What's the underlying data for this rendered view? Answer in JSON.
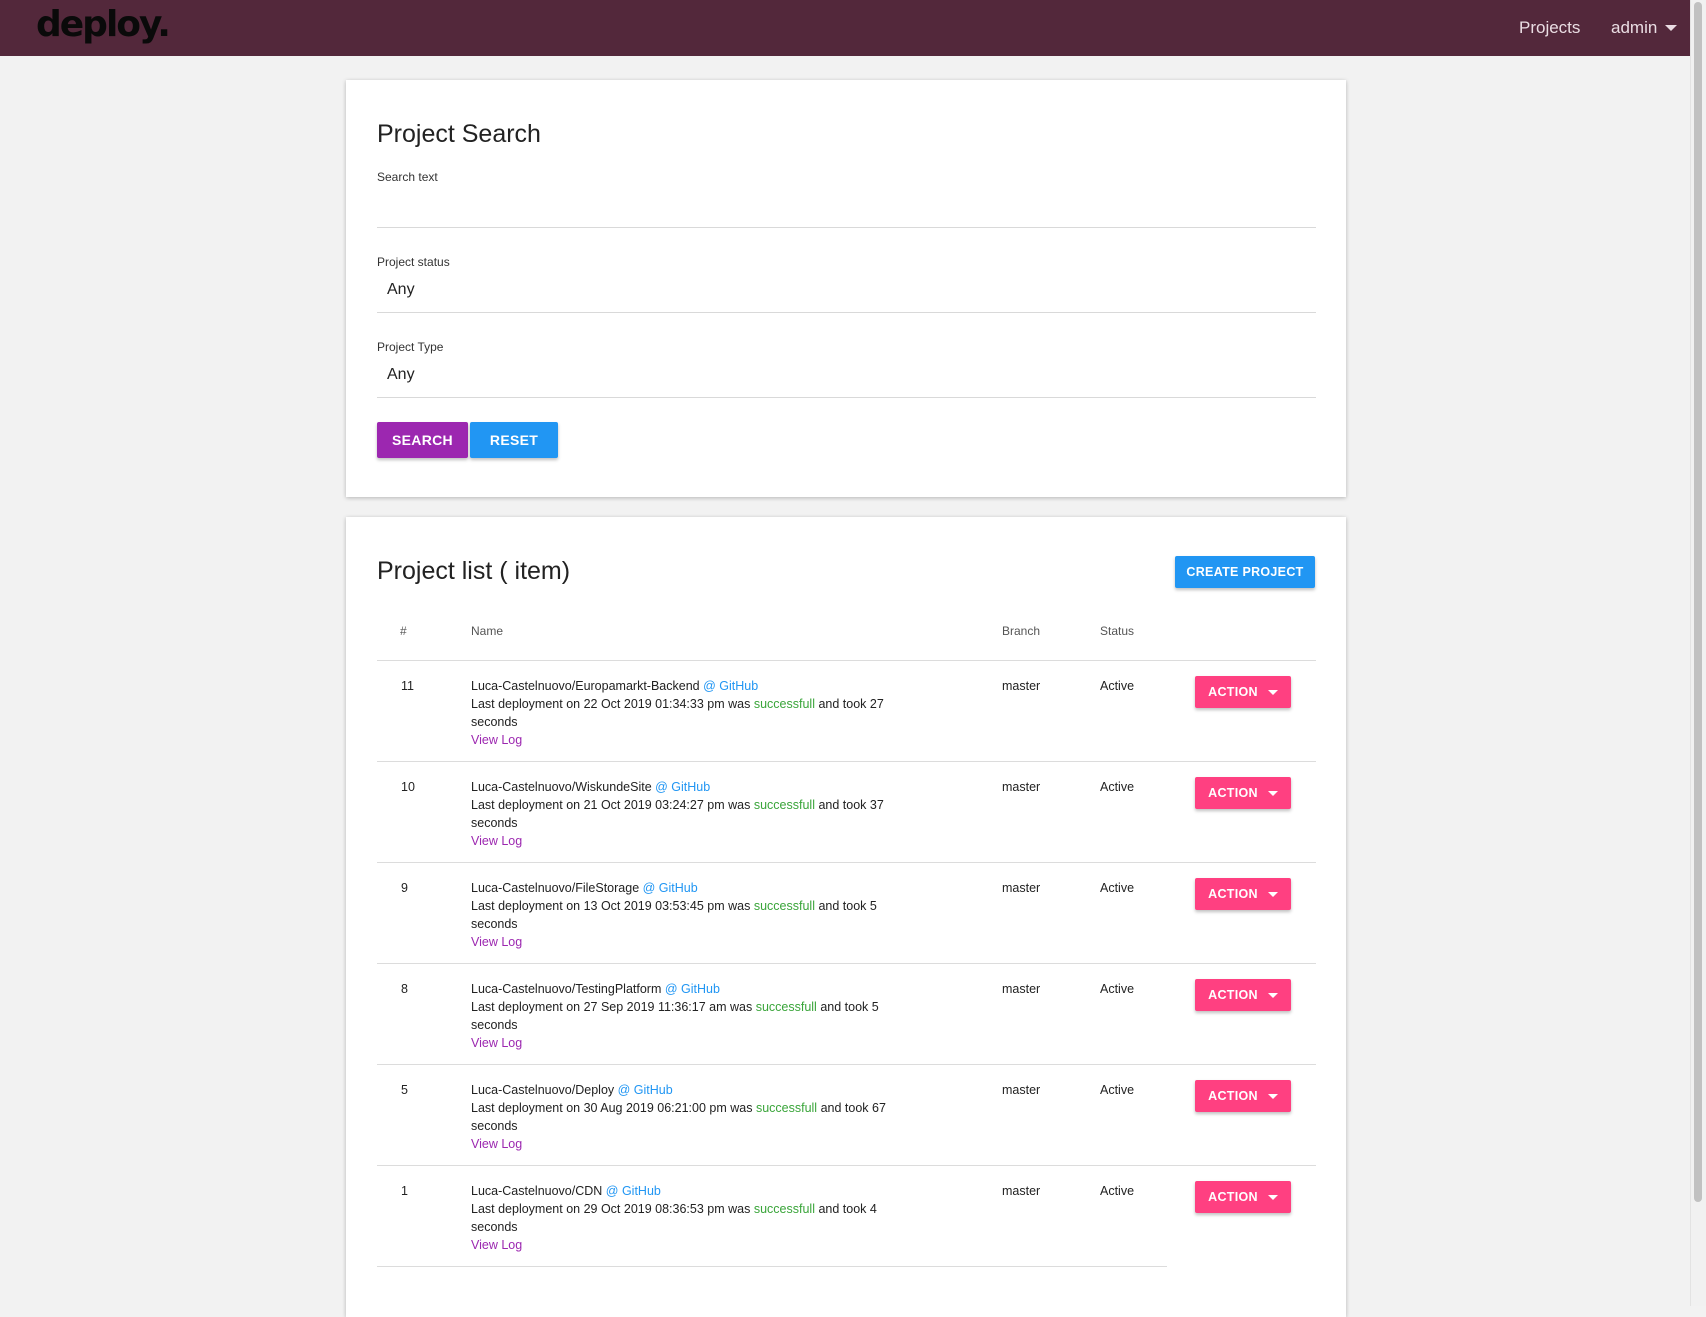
{
  "nav": {
    "brand": "deploy.",
    "projects_label": "Projects",
    "user_label": "admin"
  },
  "search": {
    "title": "Project Search",
    "search_text_label": "Search text",
    "search_text_value": "",
    "status_label": "Project status",
    "status_value": "Any",
    "type_label": "Project Type",
    "type_value": "Any",
    "search_button": "SEARCH",
    "reset_button": "RESET"
  },
  "list": {
    "title": "Project list ( item)",
    "create_button": "CREATE PROJECT",
    "columns": {
      "num": "#",
      "name": "Name",
      "branch": "Branch",
      "status": "Status"
    },
    "action_label": "ACTION",
    "rows": [
      {
        "num": "11",
        "repo": "Luca-Castelnuovo/Europamarkt-Backend",
        "provider": "@ GitHub",
        "deploy_prefix": "Last deployment on 22 Oct 2019 01:34:33 pm was",
        "result": "successfull",
        "deploy_suffix": "and took 27 seconds",
        "view_log": "View Log",
        "branch": "master",
        "status": "Active"
      },
      {
        "num": "10",
        "repo": "Luca-Castelnuovo/WiskundeSite",
        "provider": "@ GitHub",
        "deploy_prefix": "Last deployment on 21 Oct 2019 03:24:27 pm was",
        "result": "successfull",
        "deploy_suffix": "and took 37 seconds",
        "view_log": "View Log",
        "branch": "master",
        "status": "Active"
      },
      {
        "num": "9",
        "repo": "Luca-Castelnuovo/FileStorage",
        "provider": "@ GitHub",
        "deploy_prefix": "Last deployment on 13 Oct 2019 03:53:45 pm was",
        "result": "successfull",
        "deploy_suffix": "and took 5 seconds",
        "view_log": "View Log",
        "branch": "master",
        "status": "Active"
      },
      {
        "num": "8",
        "repo": "Luca-Castelnuovo/TestingPlatform",
        "provider": "@ GitHub",
        "deploy_prefix": "Last deployment on 27 Sep 2019 11:36:17 am was",
        "result": "successfull",
        "deploy_suffix": "and took 5 seconds",
        "view_log": "View Log",
        "branch": "master",
        "status": "Active"
      },
      {
        "num": "5",
        "repo": "Luca-Castelnuovo/Deploy",
        "provider": "@ GitHub",
        "deploy_prefix": "Last deployment on 30 Aug 2019 06:21:00 pm was",
        "result": "successfull",
        "deploy_suffix": "and took 67 seconds",
        "view_log": "View Log",
        "branch": "master",
        "status": "Active"
      },
      {
        "num": "1",
        "repo": "Luca-Castelnuovo/CDN",
        "provider": "@ GitHub",
        "deploy_prefix": "Last deployment on 29 Oct 2019 08:36:53 pm was",
        "result": "successfull",
        "deploy_suffix": "and took 4 seconds",
        "view_log": "View Log",
        "branch": "master",
        "status": "Active"
      }
    ]
  }
}
